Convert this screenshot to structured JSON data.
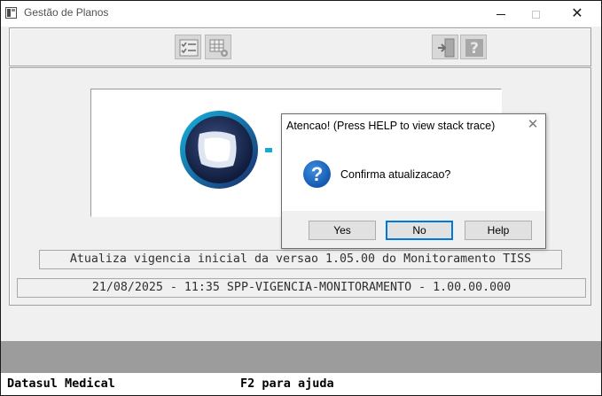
{
  "window": {
    "title": "Gestão de Planos",
    "minimize_icon": "minimize-icon",
    "maximize_icon": "maximize-icon",
    "close_glyph": "✕"
  },
  "toolbar": {
    "left_buttons": [
      "checklist-icon",
      "grid-settings-icon"
    ],
    "right_buttons": [
      "exit-door-icon",
      "help-question-icon"
    ]
  },
  "main": {
    "logo": "totvs-logo",
    "line1": "Atualiza vigencia inicial da versao 1.05.00 do Monitoramento TISS",
    "line2": "21/08/2025 - 11:35  SPP-VIGENCIA-MONITORAMENTO - 1.00.00.000"
  },
  "dialog": {
    "title": "Atencao! (Press HELP to view stack trace)",
    "close_glyph": "✕",
    "icon_glyph": "?",
    "message": "Confirma atualizacao?",
    "buttons": {
      "yes": "Yes",
      "no": "No",
      "help": "Help"
    },
    "focused_button": "No",
    "focus_color": "#0078d7"
  },
  "statusbar": {
    "left": "Datasul Medical",
    "right": "F2 para ajuda"
  }
}
